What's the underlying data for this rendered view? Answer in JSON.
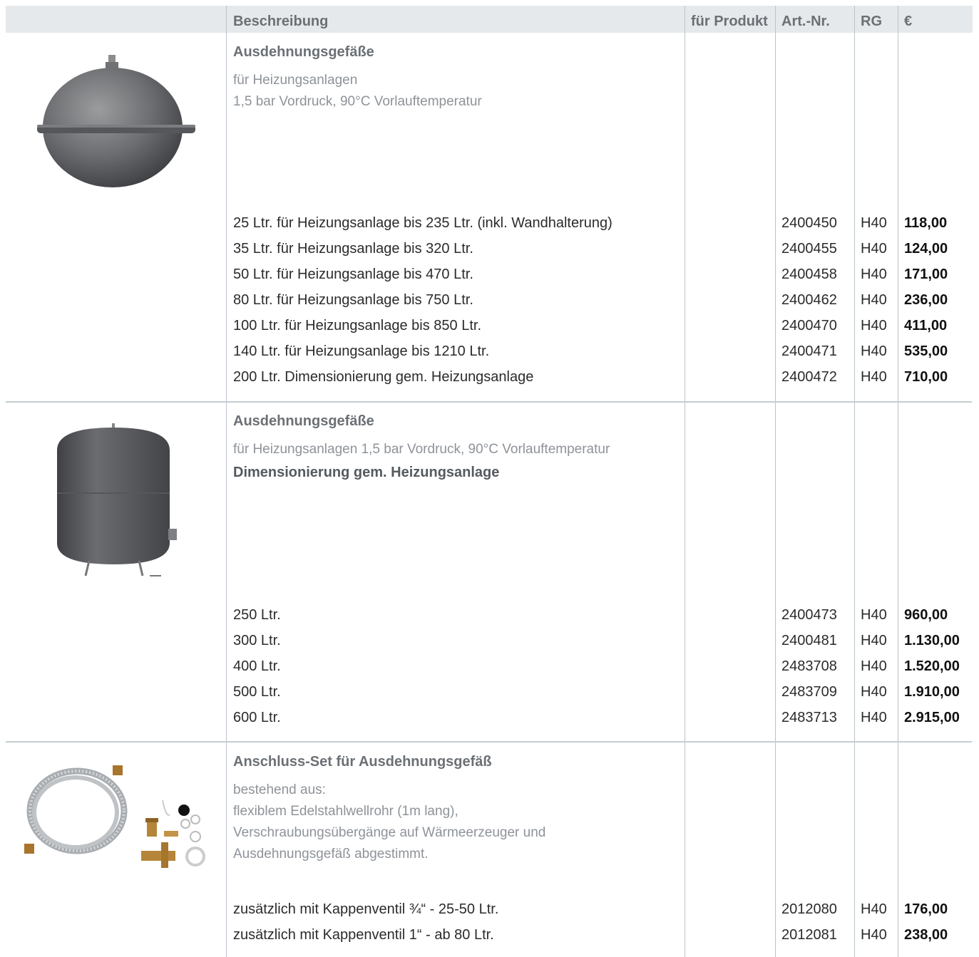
{
  "header": {
    "beschreibung": "Beschreibung",
    "fuer_produkt": "für Produkt",
    "art_nr": "Art.-Nr.",
    "rg": "RG",
    "currency": "€"
  },
  "sections": [
    {
      "title": "Ausdehnungsgefäße",
      "desc_lines": [
        "für Heizungsanlagen",
        "1,5 bar Vordruck, 90°C Vorlauftemperatur"
      ],
      "image": "expansion-vessel-wall-mounted",
      "rows": [
        {
          "desc": "25 Ltr. für Heizungsanlage bis 235 Ltr. (inkl. Wandhalterung)",
          "art": "2400450",
          "rg": "H40",
          "price": "118,00"
        },
        {
          "desc": "35 Ltr. für Heizungsanlage bis 320 Ltr.",
          "art": "2400455",
          "rg": "H40",
          "price": "124,00"
        },
        {
          "desc": "50 Ltr. für Heizungsanlage bis 470 Ltr.",
          "art": "2400458",
          "rg": "H40",
          "price": "171,00"
        },
        {
          "desc": "80 Ltr. für Heizungsanlage bis 750 Ltr.",
          "art": "2400462",
          "rg": "H40",
          "price": "236,00"
        },
        {
          "desc": "100 Ltr. für Heizungsanlage bis 850 Ltr.",
          "art": "2400470",
          "rg": "H40",
          "price": "411,00"
        },
        {
          "desc": "140 Ltr. für Heizungsanlage bis 1210 Ltr.",
          "art": "2400471",
          "rg": "H40",
          "price": "535,00"
        },
        {
          "desc": "200 Ltr. Dimensionierung gem. Heizungsanlage",
          "art": "2400472",
          "rg": "H40",
          "price": "710,00"
        }
      ]
    },
    {
      "title": "Ausdehnungsgefäße",
      "desc_lines": [
        "für Heizungsanlagen 1,5 bar Vordruck, 90°C Vorlauftemperatur"
      ],
      "desc_bold": "Dimensionierung gem. Heizungsanlage",
      "image": "expansion-vessel-floor-standing",
      "rows": [
        {
          "desc": "250 Ltr.",
          "art": "2400473",
          "rg": "H40",
          "price": "960,00"
        },
        {
          "desc": "300 Ltr.",
          "art": "2400481",
          "rg": "H40",
          "price": "1.130,00"
        },
        {
          "desc": "400 Ltr.",
          "art": "2483708",
          "rg": "H40",
          "price": "1.520,00"
        },
        {
          "desc": "500 Ltr.",
          "art": "2483709",
          "rg": "H40",
          "price": "1.910,00"
        },
        {
          "desc": "600 Ltr.",
          "art": "2483713",
          "rg": "H40",
          "price": "2.915,00"
        }
      ]
    },
    {
      "title": "Anschluss-Set für Ausdehnungsgefäß",
      "desc_lines": [
        "bestehend aus:",
        "flexiblem Edelstahlwellrohr (1m lang),",
        "Verschraubungsübergänge auf Wärmeerzeuger und",
        "Ausdehnungsgefäß abgestimmt."
      ],
      "image": "connection-set-hose-fittings",
      "rows": [
        {
          "desc": "zusätzlich mit Kappenventil ¾“ - 25-50 Ltr.",
          "art": "2012080",
          "rg": "H40",
          "price": "176,00"
        },
        {
          "desc": "zusätzlich mit Kappenventil 1“ - ab 80 Ltr.",
          "art": "2012081",
          "rg": "H40",
          "price": "238,00"
        }
      ]
    }
  ]
}
